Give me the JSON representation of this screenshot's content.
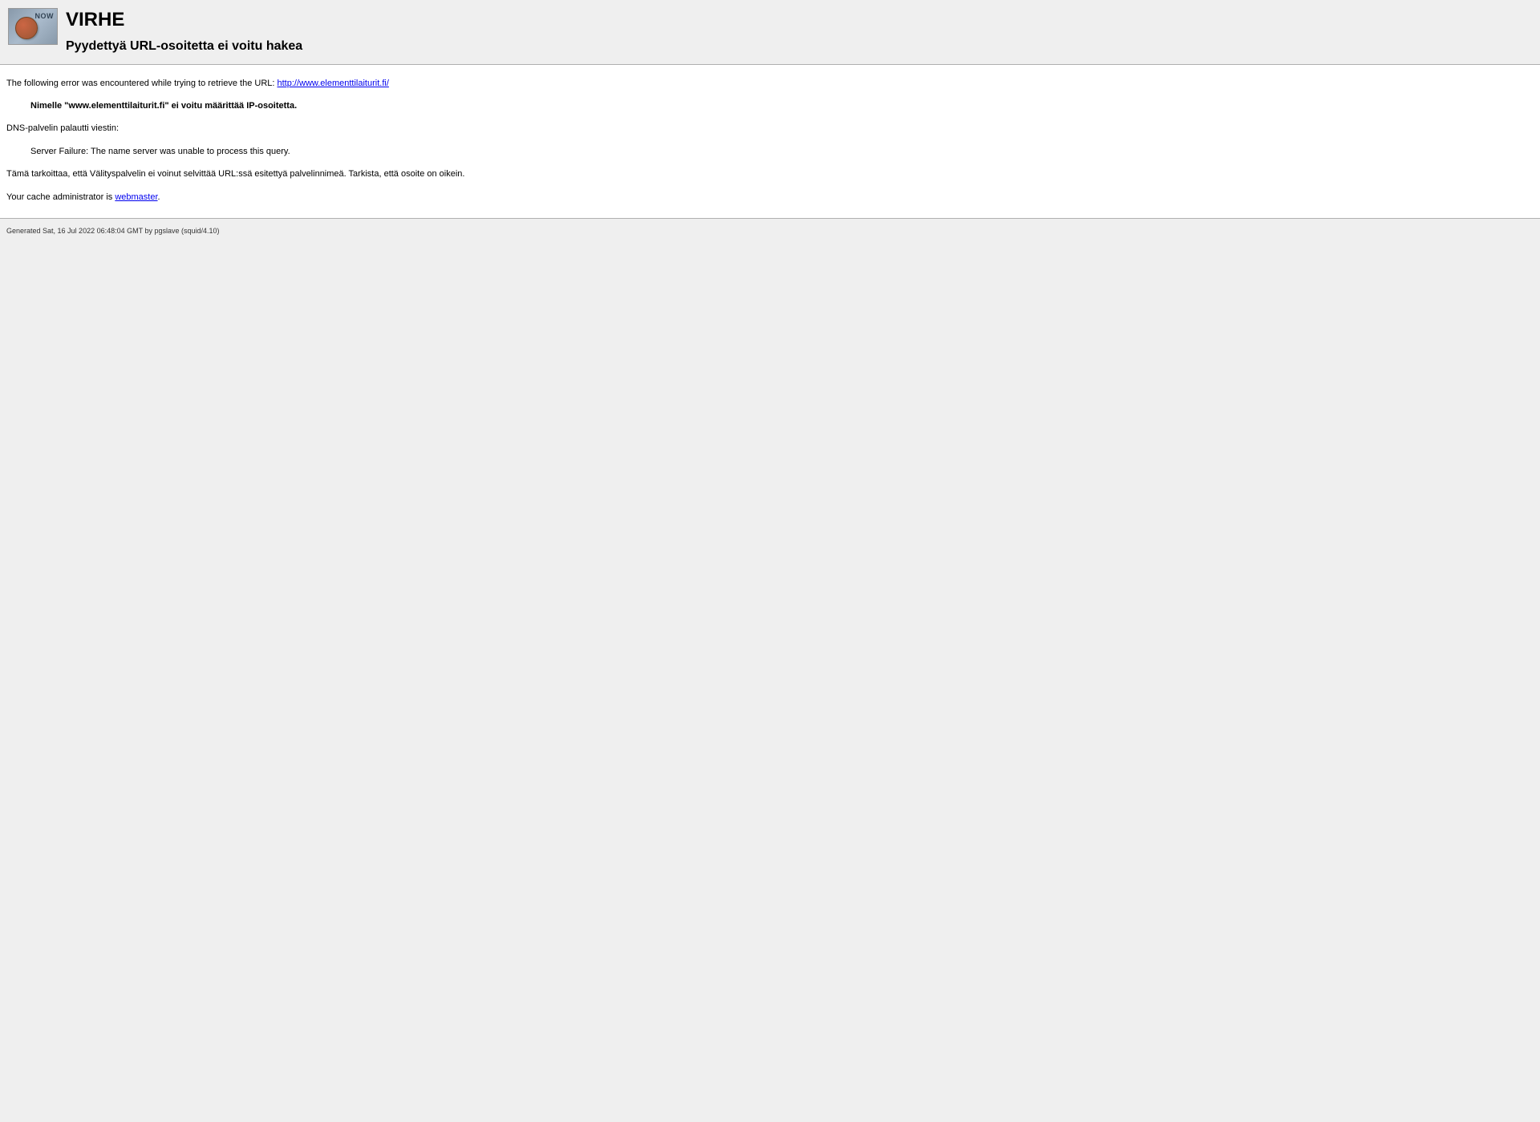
{
  "header": {
    "title": "VIRHE",
    "subtitle": "Pyydettyä URL-osoitetta ei voitu hakea"
  },
  "content": {
    "intro_prefix": "The following error was encountered while trying to retrieve the URL: ",
    "url": "http://www.elementtilaiturit.fi/",
    "error_bold": "Nimelle \"www.elementtilaiturit.fi\" ei voitu määrittää IP-osoitetta.",
    "dns_returned": "DNS-palvelin palautti viestin:",
    "dns_message": "Server Failure: The name server was unable to process this query.",
    "explanation": "Tämä tarkoittaa, että Välityspalvelin ei voinut selvittää URL:ssä esitettyä palvelinnimeä. Tarkista, että osoite on oikein.",
    "admin_prefix": "Your cache administrator is ",
    "admin_link": "webmaster",
    "admin_suffix": "."
  },
  "footer": {
    "generated": "Generated Sat, 16 Jul 2022 06:48:04 GMT by pgslave (squid/4.10)"
  }
}
